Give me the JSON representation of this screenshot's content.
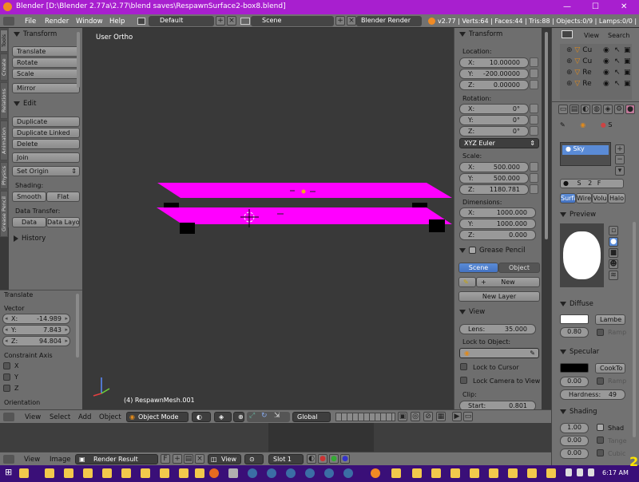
{
  "titlebar": {
    "title": "Blender [D:\\Blender 2.77a\\2.77\\blend saves\\RespawnSurface2-box8.blend]",
    "minimize": "—",
    "maximize": "☐",
    "close": "✕"
  },
  "info": {
    "menus": [
      "File",
      "Render",
      "Window",
      "Help"
    ],
    "layout": "Default",
    "scene": "Scene",
    "engine": "Blender Render",
    "stats": "v2.77 | Verts:64 | Faces:44 | Tris:88 | Objects:0/9 | Lamps:0/0 | Mem:"
  },
  "tool_tabs": [
    "Tools",
    "Create",
    "Relations",
    "Animation",
    "Physics",
    "Grease Pencil"
  ],
  "toolshelf": {
    "transform": {
      "title": "Transform",
      "buttons": [
        "Translate",
        "Rotate",
        "Scale",
        "Mirror"
      ]
    },
    "edit": {
      "title": "Edit",
      "buttons": [
        "Duplicate",
        "Duplicate Linked",
        "Delete",
        "Join",
        "Set Origin"
      ],
      "shading_label": "Shading:",
      "smooth": "Smooth",
      "flat": "Flat",
      "data_transfer_label": "Data Transfer:",
      "data": "Data",
      "data_layo": "Data Layo"
    },
    "history": "History"
  },
  "operator": {
    "title": "Translate",
    "vector_label": "Vector",
    "x_label": "X:",
    "x": "-14.989",
    "y_label": "Y:",
    "y": "7.843",
    "z_label": "Z:",
    "z": "94.804",
    "constraint_label": "Constraint Axis",
    "axes": [
      "X",
      "Y",
      "Z"
    ],
    "orientation": "Orientation"
  },
  "viewport": {
    "view_name": "User Ortho",
    "object_label": "(4) RespawnMesh.001",
    "color_plane": "#ff00ff"
  },
  "npanel": {
    "transform": "Transform",
    "location": "Location:",
    "loc_x": "10.00000",
    "loc_y": "-200.00000",
    "loc_z": "0.00000",
    "rotation": "Rotation:",
    "rot_x": "0°",
    "rot_y": "0°",
    "rot_z": "0°",
    "euler": "XYZ Euler",
    "scale": "Scale:",
    "scale_x": "500.000",
    "scale_y": "500.000",
    "scale_z": "1180.781",
    "dimensions": "Dimensions:",
    "dim_x": "1000.000",
    "dim_y": "1000.000",
    "dim_z": "0.000",
    "grease_pencil": "Grease Pencil",
    "gp_scene": "Scene",
    "gp_object": "Object",
    "gp_new": "New",
    "gp_new_layer": "New Layer",
    "view": "View",
    "lens_label": "Lens:",
    "lens": "35.000",
    "lock_to_object": "Lock to Object:",
    "lock_to_cursor": "Lock to Cursor",
    "lock_camera": "Lock Camera to View",
    "clip": "Clip:",
    "clip_start_label": "Start:",
    "clip_start": "0.801",
    "x": "X:",
    "y": "Y:",
    "z": "Z:"
  },
  "outliner": {
    "view": "View",
    "search": "Search",
    "rows": [
      "Cu",
      "Cu",
      "Re",
      "Re"
    ]
  },
  "properties": {
    "sky": "Sky",
    "tabs": [
      "Surfa",
      "Wire",
      "Volu",
      "Halo"
    ],
    "preview": "Preview",
    "diffuse": "Diffuse",
    "diffuse_shader": "Lambe",
    "diffuse_int": "0.80",
    "ramp": "Ramp",
    "specular": "Specular",
    "spec_shader": "CookTo",
    "spec_int": "0.00",
    "hardness": "Hardness:",
    "hardness_val": "49",
    "shading": "Shading",
    "shad_val": "1.00",
    "shad": "Shad",
    "tange": "Tange",
    "cubic": "Cubic",
    "emit": "0.00",
    "slot_f": "F",
    "slot_2": "2",
    "slot_s": "S"
  },
  "view3d_header": {
    "menus": [
      "View",
      "Select",
      "Add",
      "Object"
    ],
    "mode": "Object Mode",
    "orientation": "Global"
  },
  "image_header": {
    "menus": [
      "View",
      "Image"
    ],
    "render_result": "Render Result",
    "f": "F",
    "view": "View",
    "slot": "Slot 1"
  },
  "taskbar": {
    "time": "6:17 AM",
    "badge": "2"
  }
}
